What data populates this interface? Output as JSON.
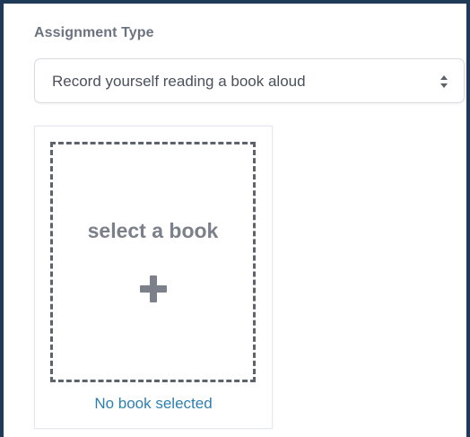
{
  "assignment_type": {
    "label": "Assignment Type",
    "selected_value": "Record yourself reading a book aloud",
    "arrow_icon": "sort-arrows-icon"
  },
  "book_picker": {
    "prompt": "select a book",
    "add_icon": "plus-icon",
    "status_text": "No book selected"
  },
  "colors": {
    "frame_border": "#1f3a56",
    "label_text": "#6b7381",
    "placeholder_text": "#7b808a",
    "link_text": "#2e7fb0"
  }
}
